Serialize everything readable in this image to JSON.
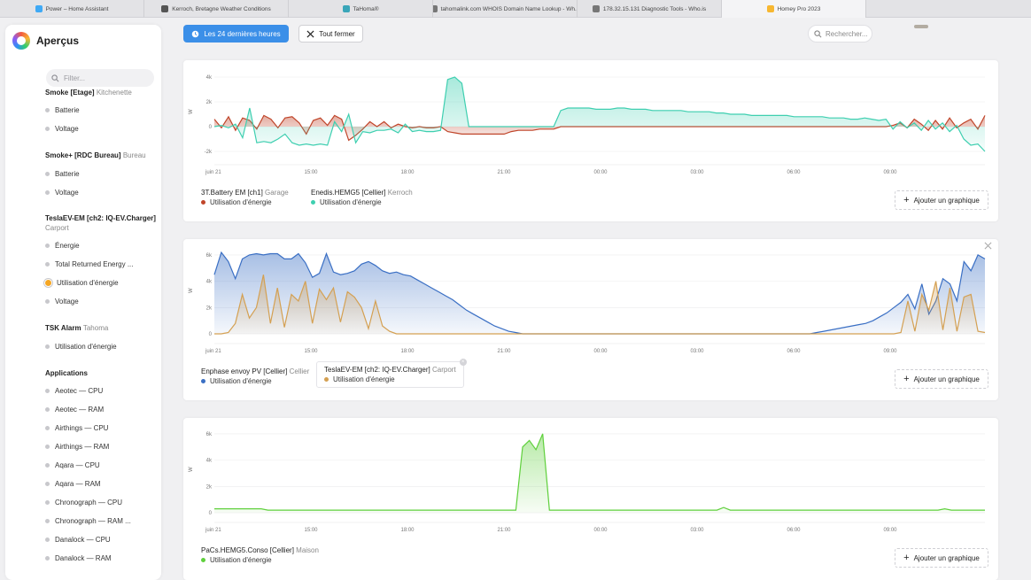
{
  "browser_tabs": [
    {
      "label": "Power – Home Assistant",
      "color": "#3fa9f5"
    },
    {
      "label": "Kerroch, Bretagne Weather Conditions",
      "color": "#555555"
    },
    {
      "label": "TaHoma®",
      "color": "#3aa6b9"
    },
    {
      "label": "tahomalink.com WHOIS Domain Name Lookup - Wh...",
      "color": "#777777"
    },
    {
      "label": "178.32.15.131 Diagnostic Tools - Who.is",
      "color": "#777777"
    },
    {
      "label": "Homey Pro 2023",
      "color": "#f7b731"
    }
  ],
  "app": {
    "title": "Aperçus"
  },
  "sidebar": {
    "filter_placeholder": "Filter...",
    "items": [
      {
        "kind": "head",
        "name": "Smoke [Etage]",
        "zone": "Kitchenette"
      },
      {
        "kind": "item",
        "label": "Batterie"
      },
      {
        "kind": "item",
        "label": "Voltage"
      },
      {
        "kind": "head",
        "name": "Smoke+ [RDC Bureau]",
        "zone": "Bureau"
      },
      {
        "kind": "item",
        "label": "Batterie"
      },
      {
        "kind": "item",
        "label": "Voltage"
      },
      {
        "kind": "head",
        "name": "TeslaEV-EM [ch2: IQ-EV.Charger]",
        "zone": ""
      },
      {
        "kind": "sub",
        "label": "Carport"
      },
      {
        "kind": "item",
        "label": "Énergie"
      },
      {
        "kind": "item",
        "label": "Total Returned Energy ..."
      },
      {
        "kind": "item",
        "label": "Utilisation d'énergie",
        "selected": true
      },
      {
        "kind": "item",
        "label": "Voltage"
      },
      {
        "kind": "head",
        "name": "TSK Alarm",
        "zone": "Tahoma"
      },
      {
        "kind": "item",
        "label": "Utilisation d'énergie"
      },
      {
        "kind": "section",
        "label": "Applications"
      },
      {
        "kind": "item",
        "label": "Aeotec — CPU"
      },
      {
        "kind": "item",
        "label": "Aeotec — RAM"
      },
      {
        "kind": "item",
        "label": "Airthings — CPU"
      },
      {
        "kind": "item",
        "label": "Airthings — RAM"
      },
      {
        "kind": "item",
        "label": "Aqara — CPU"
      },
      {
        "kind": "item",
        "label": "Aqara — RAM"
      },
      {
        "kind": "item",
        "label": "Chronograph — CPU"
      },
      {
        "kind": "item",
        "label": "Chronograph — RAM ..."
      },
      {
        "kind": "item",
        "label": "Danalock — CPU"
      },
      {
        "kind": "item",
        "label": "Danalock — RAM"
      }
    ]
  },
  "toolbar": {
    "range_label": "Les 24 dernières heures",
    "close_all_label": "Tout fermer",
    "search_placeholder": "Rechercher..."
  },
  "add_chart_label": "Ajouter un graphique",
  "chart_data": [
    {
      "type": "area",
      "ylabel": "W",
      "yticks": [
        "4k",
        "2k",
        "0",
        "-2k"
      ],
      "ylim": [
        -2500,
        4500
      ],
      "xticks": [
        "juin 21",
        "15:00",
        "18:00",
        "21:00",
        "00:00",
        "03:00",
        "06:00",
        "09:00"
      ],
      "grid": true,
      "legend_placement": "bottom-left",
      "series": [
        {
          "name": "3T.Battery EM [ch1]",
          "zone": "Garage",
          "metric": "Utilisation d'énergie",
          "color": "#c0452a",
          "values": [
            600,
            -100,
            800,
            -300,
            700,
            500,
            -200,
            900,
            600,
            -100,
            700,
            800,
            300,
            -600,
            500,
            700,
            100,
            900,
            600,
            -1100,
            -700,
            -200,
            400,
            0,
            400,
            -100,
            200,
            0,
            -100,
            0,
            -100,
            -100,
            0,
            -400,
            -500,
            -600,
            -600,
            -600,
            -600,
            -600,
            -600,
            -600,
            -400,
            -300,
            -300,
            -300,
            -200,
            -200,
            -200,
            0,
            0,
            0,
            0,
            0,
            0,
            0,
            0,
            0,
            0,
            0,
            0,
            0,
            0,
            0,
            0,
            0,
            0,
            0,
            0,
            0,
            0,
            0,
            0,
            0,
            0,
            0,
            0,
            0,
            0,
            0,
            0,
            0,
            0,
            0,
            0,
            0,
            0,
            0,
            0,
            0,
            0,
            0,
            0,
            0,
            0,
            0,
            100,
            300,
            -100,
            600,
            200,
            -300,
            500,
            -200,
            700,
            -100,
            300,
            600,
            -200,
            900
          ]
        },
        {
          "name": "Enedis.HEMG5 [Cellier]",
          "zone": "Kerroch",
          "metric": "Utilisation d'énergie",
          "color": "#3ecfb0",
          "values": [
            0,
            100,
            -100,
            200,
            -900,
            1500,
            -1300,
            -1200,
            -1300,
            -1000,
            -600,
            -1300,
            -1500,
            -1400,
            -1500,
            -1400,
            -1500,
            400,
            -400,
            1000,
            -1300,
            -400,
            -500,
            -300,
            -300,
            -200,
            -500,
            200,
            -400,
            -300,
            -400,
            -400,
            -300,
            3800,
            4000,
            3500,
            0,
            0,
            0,
            0,
            0,
            0,
            0,
            0,
            0,
            0,
            0,
            0,
            0,
            1300,
            1500,
            1500,
            1500,
            1500,
            1400,
            1400,
            1400,
            1500,
            1500,
            1400,
            1400,
            1400,
            1300,
            1300,
            1300,
            1300,
            1300,
            1200,
            1200,
            1200,
            1200,
            1100,
            1100,
            1000,
            1000,
            1000,
            900,
            900,
            900,
            900,
            900,
            900,
            800,
            800,
            800,
            800,
            800,
            700,
            700,
            700,
            600,
            600,
            700,
            600,
            500,
            600,
            -200,
            400,
            -100,
            300,
            -300,
            500,
            -200,
            300,
            -400,
            100,
            -1000,
            -1500,
            -1400,
            -2000
          ]
        }
      ]
    },
    {
      "type": "area",
      "ylabel": "W",
      "yticks": [
        "6k",
        "4k",
        "2k",
        "0"
      ],
      "ylim": [
        -200,
        6400
      ],
      "xticks": [
        "juin 21",
        "15:00",
        "18:00",
        "21:00",
        "00:00",
        "03:00",
        "06:00",
        "09:00"
      ],
      "grid": true,
      "legend_placement": "bottom-left",
      "series": [
        {
          "name": "Enphase envoy PV [Cellier]",
          "zone": "Cellier",
          "metric": "Utilisation d'énergie",
          "color": "#3a6fc4",
          "values": [
            4500,
            6200,
            5500,
            4200,
            5700,
            6000,
            6100,
            6000,
            6100,
            6100,
            5700,
            5700,
            6100,
            5400,
            4300,
            4600,
            6100,
            4700,
            4500,
            4600,
            4800,
            5300,
            5500,
            5200,
            4800,
            4600,
            4700,
            4500,
            4400,
            4100,
            3800,
            3500,
            3200,
            2900,
            2600,
            2200,
            1800,
            1500,
            1200,
            900,
            600,
            400,
            200,
            100,
            0,
            0,
            0,
            0,
            0,
            0,
            0,
            0,
            0,
            0,
            0,
            0,
            0,
            0,
            0,
            0,
            0,
            0,
            0,
            0,
            0,
            0,
            0,
            0,
            0,
            0,
            0,
            0,
            0,
            0,
            0,
            0,
            0,
            0,
            0,
            0,
            0,
            0,
            0,
            0,
            0,
            0,
            100,
            200,
            300,
            400,
            500,
            600,
            700,
            800,
            1000,
            1300,
            1600,
            2000,
            2400,
            3000,
            1900,
            3800,
            1500,
            2500,
            4200,
            3800,
            2500,
            5500,
            4800,
            6000,
            5700
          ]
        },
        {
          "name": "TeslaEV-EM [ch2: IQ-EV.Charger]",
          "zone": "Carport",
          "metric": "Utilisation d'énergie",
          "color": "#d4a052",
          "values": [
            0,
            0,
            100,
            800,
            3000,
            1200,
            2000,
            4500,
            800,
            3500,
            500,
            3000,
            2500,
            4000,
            800,
            3400,
            2600,
            3500,
            900,
            3200,
            2800,
            2000,
            400,
            2500,
            600,
            200,
            0,
            0,
            0,
            0,
            0,
            0,
            0,
            0,
            0,
            0,
            0,
            0,
            0,
            0,
            0,
            0,
            0,
            0,
            0,
            0,
            0,
            0,
            0,
            0,
            0,
            0,
            0,
            0,
            0,
            0,
            0,
            0,
            0,
            0,
            0,
            0,
            0,
            0,
            0,
            0,
            0,
            0,
            0,
            0,
            0,
            0,
            0,
            0,
            0,
            0,
            0,
            0,
            0,
            0,
            0,
            0,
            0,
            0,
            0,
            0,
            0,
            0,
            0,
            0,
            0,
            0,
            0,
            0,
            0,
            0,
            0,
            0,
            100,
            2500,
            200,
            3000,
            1800,
            4000,
            300,
            3500,
            200,
            2800,
            3000,
            200,
            100
          ]
        }
      ]
    },
    {
      "type": "area",
      "ylabel": "W",
      "yticks": [
        "6k",
        "4k",
        "2k",
        "0"
      ],
      "ylim": [
        -200,
        6400
      ],
      "xticks": [
        "juin 21",
        "15:00",
        "18:00",
        "21:00",
        "00:00",
        "03:00",
        "06:00",
        "09:00"
      ],
      "grid": true,
      "legend_placement": "bottom-left",
      "series": [
        {
          "name": "PaCs.HEMG5.Conso [Cellier]",
          "zone": "Maison",
          "metric": "Utilisation d'énergie",
          "color": "#5fd03c",
          "values": [
            300,
            300,
            300,
            300,
            300,
            300,
            300,
            300,
            200,
            200,
            200,
            200,
            200,
            200,
            200,
            200,
            200,
            200,
            200,
            200,
            200,
            200,
            200,
            200,
            200,
            200,
            200,
            200,
            200,
            200,
            200,
            200,
            200,
            200,
            200,
            200,
            200,
            200,
            200,
            200,
            200,
            200,
            200,
            200,
            200,
            200,
            5000,
            5500,
            4800,
            6000,
            200,
            200,
            200,
            200,
            200,
            200,
            200,
            200,
            200,
            200,
            200,
            200,
            200,
            200,
            200,
            200,
            200,
            200,
            200,
            200,
            200,
            200,
            200,
            200,
            200,
            200,
            400,
            200,
            200,
            200,
            200,
            200,
            200,
            200,
            200,
            200,
            200,
            200,
            200,
            200,
            200,
            200,
            200,
            200,
            200,
            200,
            200,
            200,
            200,
            200,
            200,
            200,
            200,
            200,
            200,
            200,
            200,
            200,
            200,
            300,
            200,
            200,
            200,
            200,
            200,
            200
          ]
        }
      ]
    }
  ]
}
